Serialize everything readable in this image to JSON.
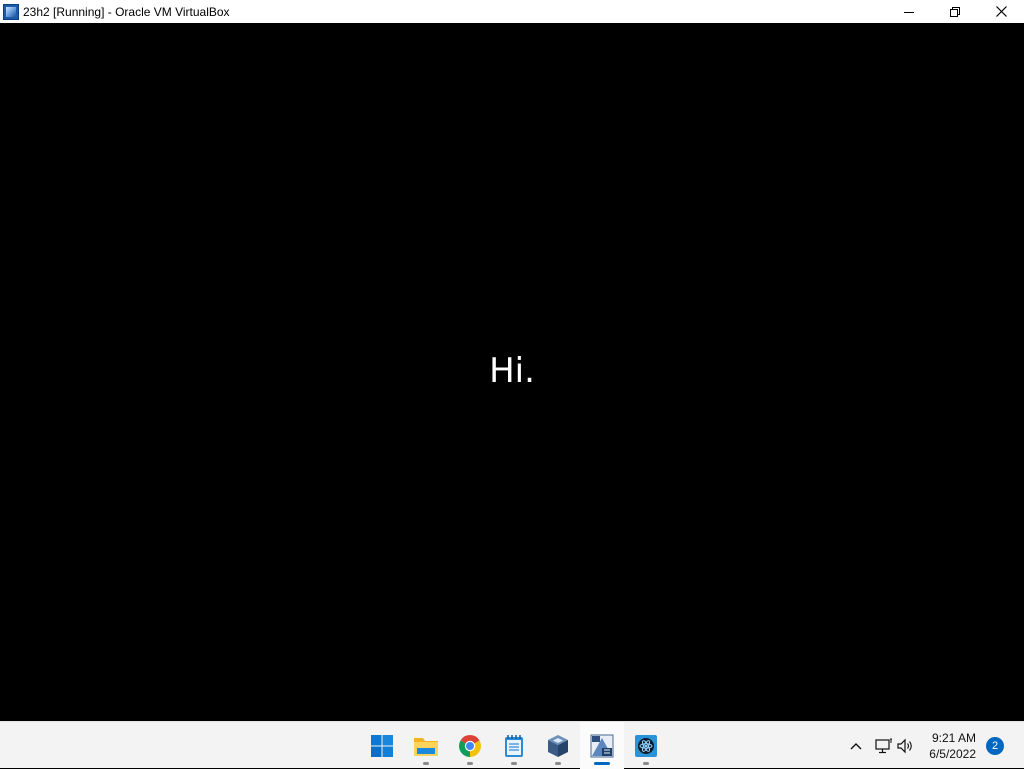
{
  "window": {
    "title": "23h2 [Running] - Oracle VM VirtualBox",
    "icon": "virtualbox-vm-icon"
  },
  "window_controls": [
    "minimize-icon",
    "restore-icon",
    "close-icon"
  ],
  "vm_screen": {
    "greeting": "Hi."
  },
  "taskbar": {
    "apps": [
      {
        "name": "start",
        "icon": "windows-start-icon",
        "active": false
      },
      {
        "name": "file-explorer",
        "icon": "folder-icon",
        "active": false
      },
      {
        "name": "chrome",
        "icon": "chrome-icon",
        "active": false
      },
      {
        "name": "notepad",
        "icon": "notepad-icon",
        "active": false
      },
      {
        "name": "virtualbox",
        "icon": "virtualbox-cube-icon",
        "active": false
      },
      {
        "name": "virtualbox-vm",
        "icon": "virtualbox-vm-icon",
        "active": true
      },
      {
        "name": "unknown-app",
        "icon": "atom-app-icon",
        "active": false
      }
    ],
    "tray": {
      "icons": [
        "chevron-up-icon",
        "network-icon",
        "speaker-icon"
      ],
      "time": "9:21 AM",
      "date": "6/5/2022",
      "notifications": "2"
    }
  },
  "colors": {
    "accent": "#0067c0",
    "taskbar_bg": "#f3f3f3",
    "screen_bg": "#000000"
  }
}
